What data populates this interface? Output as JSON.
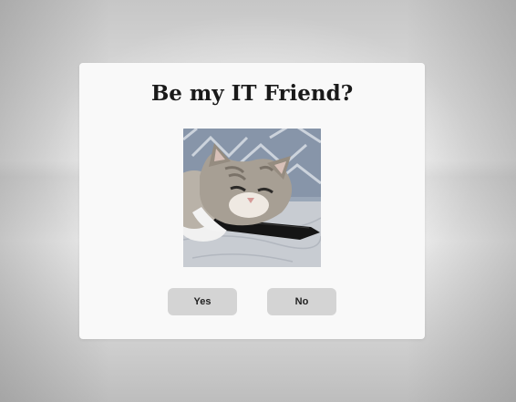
{
  "dialog": {
    "title_normal": "Be my IT ",
    "title_bold": "Friend?",
    "image": {
      "alt": "cat-resting-on-phone",
      "subject": "cat"
    },
    "buttons": {
      "yes_label": "Yes",
      "no_label": "No"
    }
  },
  "colors": {
    "card_background": "#f9f9f9",
    "button_background": "#d4d4d4",
    "title_text": "#1a1a1a"
  }
}
